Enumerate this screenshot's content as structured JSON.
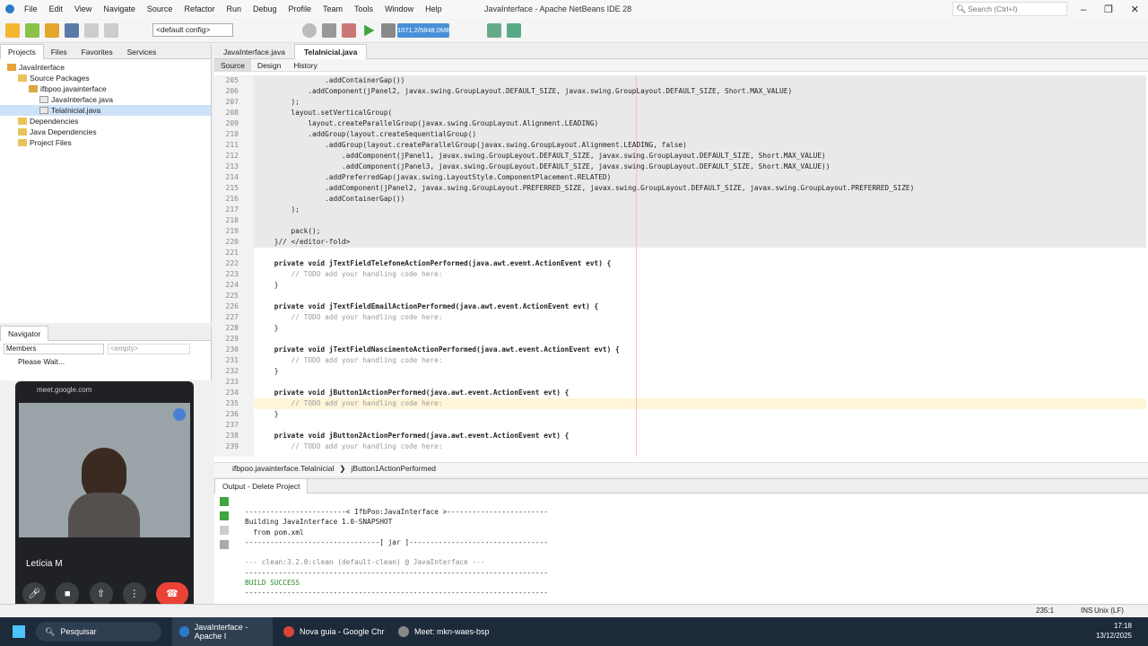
{
  "app": {
    "title": "JavaInterface - Apache NetBeans IDE 28",
    "menu": [
      "File",
      "Edit",
      "View",
      "Navigate",
      "Source",
      "Refactor",
      "Run",
      "Debug",
      "Profile",
      "Team",
      "Tools",
      "Window",
      "Help"
    ],
    "search_placeholder": "Search (Ctrl+I)",
    "config": "<default config>",
    "memory": "1071,2/5848,0MB"
  },
  "left_panel": {
    "tabs": [
      "Projects",
      "Files",
      "Favorites",
      "Services"
    ],
    "tree": [
      {
        "label": "JavaInterface",
        "indent": 0,
        "icon": "project-icon",
        "selected": false
      },
      {
        "label": "Source Packages",
        "indent": 1,
        "icon": "folder-icon",
        "selected": false
      },
      {
        "label": "ifbpoo.javainterface",
        "indent": 2,
        "icon": "package-icon",
        "selected": false
      },
      {
        "label": "JavaInterface.java",
        "indent": 3,
        "icon": "java-file-icon",
        "selected": false
      },
      {
        "label": "TelaInicial.java",
        "indent": 3,
        "icon": "java-file-icon",
        "selected": true
      },
      {
        "label": "Dependencies",
        "indent": 1,
        "icon": "folder-icon",
        "selected": false
      },
      {
        "label": "Java Dependencies",
        "indent": 1,
        "icon": "folder-icon",
        "selected": false
      },
      {
        "label": "Project Files",
        "indent": 1,
        "icon": "folder-icon",
        "selected": false
      }
    ]
  },
  "navigator": {
    "title": "Navigator",
    "members": "Members",
    "empty": "<empty>",
    "status": "Please Wait..."
  },
  "meet": {
    "url": "meet.google.com",
    "participant": "Letícia M"
  },
  "editor": {
    "tabs": [
      "JavaInterface.java",
      "TelaInicial.java"
    ],
    "active_tab": 1,
    "modes": [
      "Source",
      "Design",
      "History"
    ],
    "lines": [
      {
        "n": "205",
        "t": "                .addContainerGap())",
        "k": ""
      },
      {
        "n": "206",
        "t": "            .addComponent(jPanel2, javax.swing.GroupLayout.DEFAULT_SIZE, javax.swing.GroupLayout.DEFAULT_SIZE, Short.MAX_VALUE)",
        "k": ""
      },
      {
        "n": "207",
        "t": "        );",
        "k": ""
      },
      {
        "n": "208",
        "t": "        layout.setVerticalGroup(",
        "k": ""
      },
      {
        "n": "209",
        "t": "            layout.createParallelGroup(javax.swing.GroupLayout.Alignment.LEADING)",
        "k": ""
      },
      {
        "n": "210",
        "t": "            .addGroup(layout.createSequentialGroup()",
        "k": ""
      },
      {
        "n": "211",
        "t": "                .addGroup(layout.createParallelGroup(javax.swing.GroupLayout.Alignment.LEADING, false)",
        "k": ""
      },
      {
        "n": "212",
        "t": "                    .addComponent(jPanel1, javax.swing.GroupLayout.DEFAULT_SIZE, javax.swing.GroupLayout.DEFAULT_SIZE, Short.MAX_VALUE)",
        "k": ""
      },
      {
        "n": "213",
        "t": "                    .addComponent(jPanel3, javax.swing.GroupLayout.DEFAULT_SIZE, javax.swing.GroupLayout.DEFAULT_SIZE, Short.MAX_VALUE))",
        "k": ""
      },
      {
        "n": "214",
        "t": "                .addPreferredGap(javax.swing.LayoutStyle.ComponentPlacement.RELATED)",
        "k": ""
      },
      {
        "n": "215",
        "t": "                .addComponent(jPanel2, javax.swing.GroupLayout.PREFERRED_SIZE, javax.swing.GroupLayout.DEFAULT_SIZE, javax.swing.GroupLayout.PREFERRED_SIZE)",
        "k": ""
      },
      {
        "n": "216",
        "t": "                .addContainerGap())",
        "k": ""
      },
      {
        "n": "217",
        "t": "        );",
        "k": ""
      },
      {
        "n": "218",
        "t": "",
        "k": ""
      },
      {
        "n": "219",
        "t": "        pack();",
        "k": ""
      },
      {
        "n": "220",
        "t": "    }// </editor-fold>",
        "k": "fold"
      },
      {
        "n": "221",
        "t": "",
        "k": "plain"
      },
      {
        "n": "222",
        "t": "    private void jTextFieldTelefoneActionPerformed(java.awt.event.ActionEvent evt) {",
        "k": "method"
      },
      {
        "n": "223",
        "t": "        // TODO add your handling code here:",
        "k": "comment"
      },
      {
        "n": "224",
        "t": "    }",
        "k": "plain"
      },
      {
        "n": "225",
        "t": "",
        "k": "plain"
      },
      {
        "n": "226",
        "t": "    private void jTextFieldEmailActionPerformed(java.awt.event.ActionEvent evt) {",
        "k": "method"
      },
      {
        "n": "227",
        "t": "        // TODO add your handling code here:",
        "k": "comment"
      },
      {
        "n": "228",
        "t": "    }",
        "k": "plain"
      },
      {
        "n": "229",
        "t": "",
        "k": "plain"
      },
      {
        "n": "230",
        "t": "    private void jTextFieldNascimentoActionPerformed(java.awt.event.ActionEvent evt) {",
        "k": "method"
      },
      {
        "n": "231",
        "t": "        // TODO add your handling code here:",
        "k": "comment"
      },
      {
        "n": "232",
        "t": "    }",
        "k": "plain"
      },
      {
        "n": "233",
        "t": "",
        "k": "plain"
      },
      {
        "n": "234",
        "t": "    private void jButton1ActionPerformed(java.awt.event.ActionEvent evt) {",
        "k": "method"
      },
      {
        "n": "235",
        "t": "        // TODO add your handling code here:",
        "k": "current"
      },
      {
        "n": "236",
        "t": "    }",
        "k": "plain"
      },
      {
        "n": "237",
        "t": "",
        "k": "plain"
      },
      {
        "n": "238",
        "t": "    private void jButton2ActionPerformed(java.awt.event.ActionEvent evt) {",
        "k": "method"
      },
      {
        "n": "239",
        "t": "        // TODO add your handling code here:",
        "k": "comment"
      }
    ],
    "breadcrumb": [
      "ifbpoo.javainterface.TelaInicial",
      "jButton1ActionPerformed"
    ]
  },
  "output": {
    "title": "Output - Delete Project",
    "lines": [
      "------------------------< IfbPoo:JavaInterface >------------------------",
      "Building JavaInterface 1.0-SNAPSHOT",
      "  from pom.xml",
      "--------------------------------[ jar ]---------------------------------",
      "",
      "--- clean:3.2.0:clean (default-clean) @ JavaInterface ---",
      "------------------------------------------------------------------------",
      "BUILD SUCCESS",
      "------------------------------------------------------------------------"
    ]
  },
  "status": {
    "position": "235:1",
    "mode": "INS",
    "eol": "Unix (LF)"
  },
  "taskbar": {
    "search": "Pesquisar",
    "apps": [
      "JavaInterface - Apache I",
      "Nova guia - Google Chr",
      "Meet: mkn-waes-bsp"
    ],
    "time": "17:18",
    "date": "13/12/2025"
  },
  "colors": {
    "keyword": "#1d56c4",
    "comment": "#9a9a9a",
    "selection": "#cde2f7",
    "end_call": "#ea4335"
  }
}
